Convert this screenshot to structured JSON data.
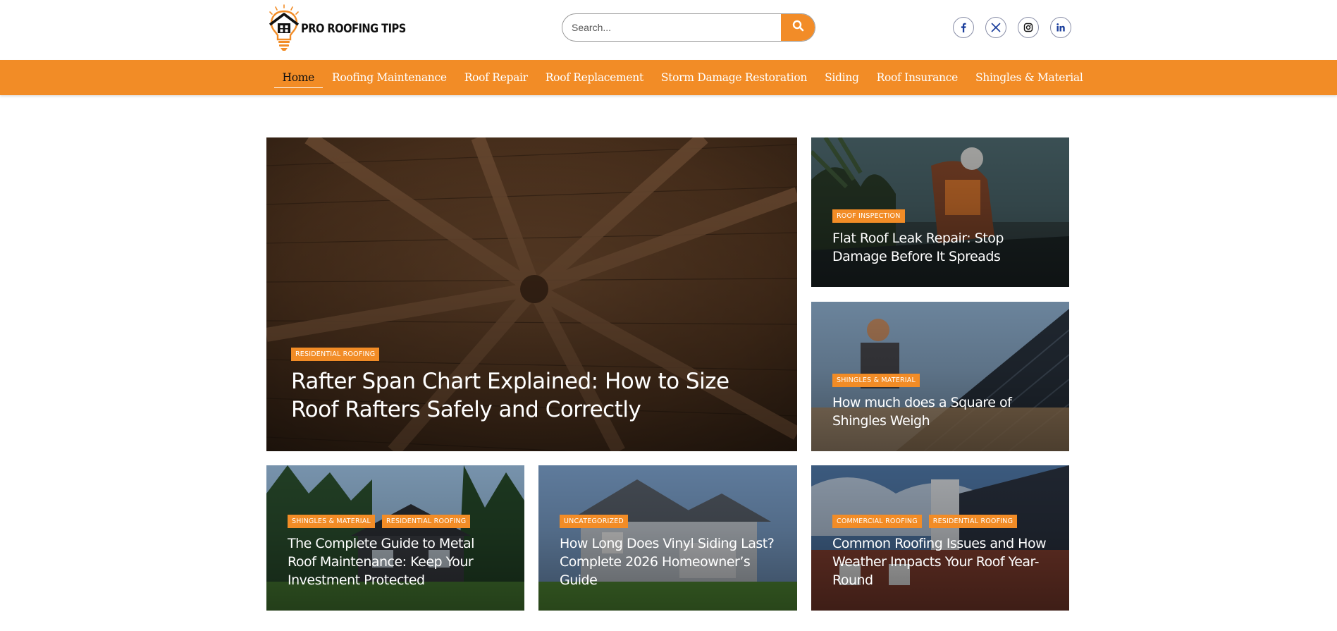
{
  "header": {
    "logo_text": "PRO ROOFING TIPS",
    "search_placeholder": "Search...",
    "social": [
      "facebook-icon",
      "x-twitter-icon",
      "instagram-icon",
      "linkedin-icon"
    ]
  },
  "nav": {
    "items": [
      {
        "label": "Home",
        "active": true
      },
      {
        "label": "Roofing Maintenance"
      },
      {
        "label": "Roof Repair"
      },
      {
        "label": "Roof Replacement"
      },
      {
        "label": "Storm Damage Restoration"
      },
      {
        "label": "Siding"
      },
      {
        "label": "Roof Insurance"
      },
      {
        "label": "Shingles & Material"
      }
    ]
  },
  "colors": {
    "accent": "#f28c26",
    "nav_active_text": "#111111"
  },
  "posts": {
    "featured": {
      "tags": [
        "RESIDENTIAL ROOFING"
      ],
      "title": "Rafter Span Chart Explained: How to Size Roof Rafters Safely and Correctly"
    },
    "side1": {
      "tags": [
        "ROOF INSPECTION"
      ],
      "title": "Flat Roof Leak Repair: Stop Damage Before It Spreads"
    },
    "side2": {
      "tags": [
        "SHINGLES & MATERIAL"
      ],
      "title": "How much does a Square of Shingles Weigh"
    },
    "row1": {
      "tags": [
        "SHINGLES & MATERIAL",
        "RESIDENTIAL ROOFING"
      ],
      "title": "The Complete Guide to Metal Roof Maintenance: Keep Your Investment Protected"
    },
    "row2": {
      "tags": [
        "UNCATEGORIZED"
      ],
      "title": "How Long Does Vinyl Siding Last? Complete 2026 Homeowner’s Guide"
    },
    "row3": {
      "tags": [
        "COMMERCIAL ROOFING",
        "RESIDENTIAL ROOFING"
      ],
      "title": "Common Roofing Issues and How Weather Impacts Your Roof Year-Round"
    }
  }
}
